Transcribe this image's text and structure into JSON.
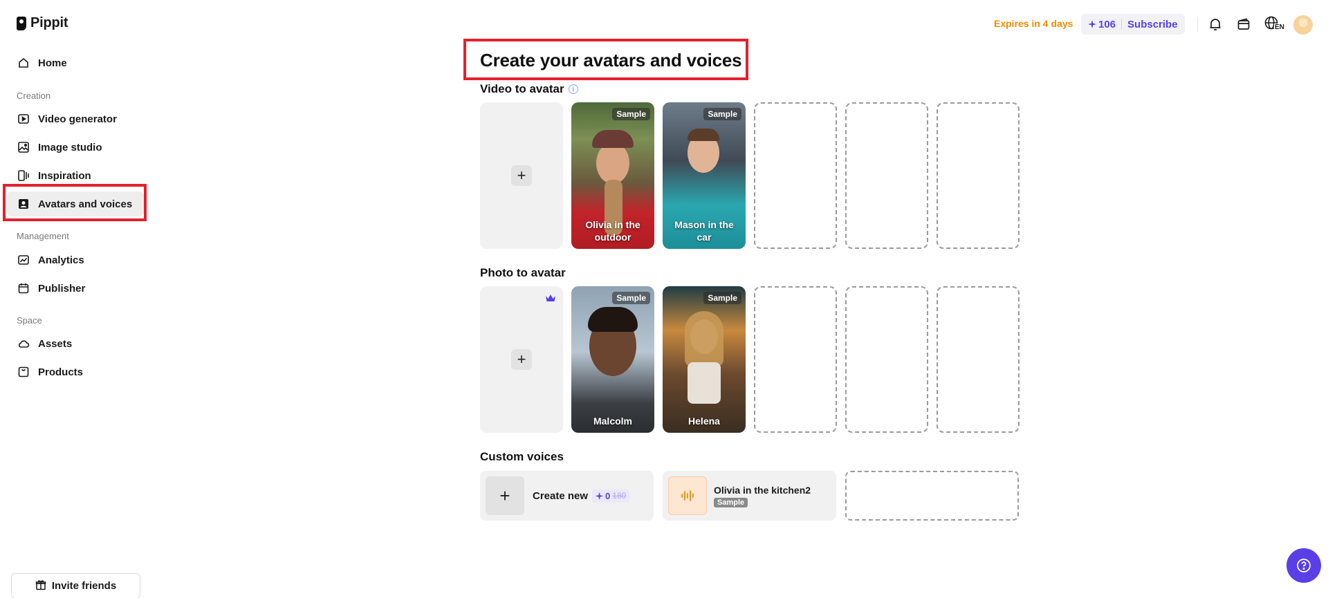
{
  "brand": {
    "name": "Pippit"
  },
  "sidebar": {
    "home": "Home",
    "sections": {
      "creation": "Creation",
      "management": "Management",
      "space": "Space"
    },
    "items": {
      "video_generator": "Video generator",
      "image_studio": "Image studio",
      "inspiration": "Inspiration",
      "avatars_and_voices": "Avatars and voices",
      "analytics": "Analytics",
      "publisher": "Publisher",
      "assets": "Assets",
      "products": "Products"
    },
    "invite": "Invite friends"
  },
  "topbar": {
    "expires": "Expires in 4 days",
    "credits": "106",
    "subscribe": "Subscribe",
    "language": "EN"
  },
  "main": {
    "title": "Create your avatars and voices",
    "video_to_avatar": {
      "title": "Video to avatar",
      "samples": [
        {
          "name": "Olivia in the outdoor",
          "tag": "Sample"
        },
        {
          "name": "Mason in the car",
          "tag": "Sample"
        }
      ]
    },
    "photo_to_avatar": {
      "title": "Photo to avatar",
      "samples": [
        {
          "name": "Malcolm",
          "tag": "Sample"
        },
        {
          "name": "Helena",
          "tag": "Sample"
        }
      ]
    },
    "custom_voices": {
      "title": "Custom voices",
      "create_new": "Create new",
      "cost": "0",
      "original_cost": "180",
      "sample_voice": {
        "name": "Olivia in the kitchen2",
        "tag": "Sample"
      }
    }
  },
  "colors": {
    "accent": "#5a3ee8",
    "expires": "#f08c00",
    "highlight": "#e5202c"
  }
}
